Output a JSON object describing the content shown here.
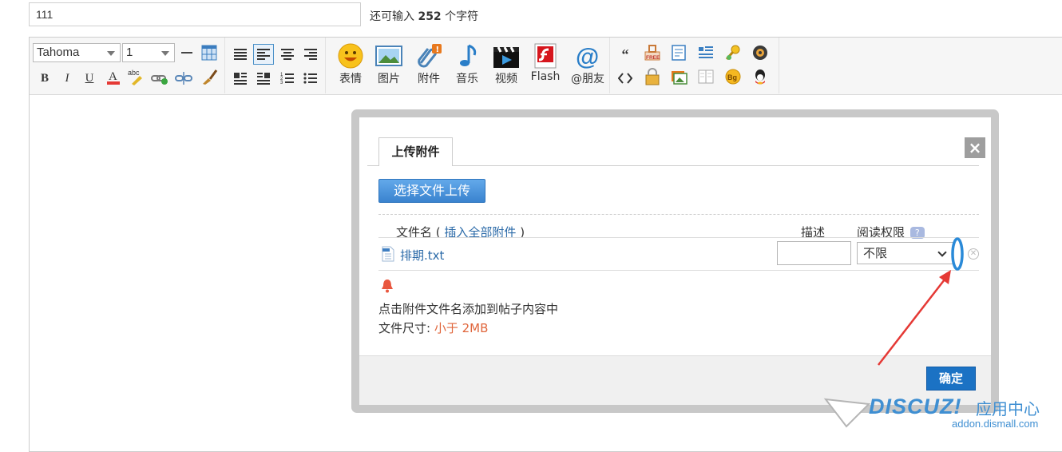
{
  "subject": {
    "value": "111"
  },
  "char_hint": {
    "prefix": "还可输入",
    "count": "252",
    "suffix": "个字符"
  },
  "toolbar": {
    "font_family": "Tahoma",
    "font_size": "1",
    "buttons": [
      {
        "name": "emoji",
        "label": "表情",
        "icon": "smiley-icon"
      },
      {
        "name": "image",
        "label": "图片",
        "icon": "image-icon"
      },
      {
        "name": "attachment",
        "label": "附件",
        "icon": "paperclip-icon"
      },
      {
        "name": "music",
        "label": "音乐",
        "icon": "music-note-icon"
      },
      {
        "name": "video",
        "label": "视频",
        "icon": "clapperboard-icon"
      },
      {
        "name": "flash",
        "label": "Flash",
        "icon": "flash-icon"
      },
      {
        "name": "mention",
        "label": "@朋友",
        "icon": "at-icon"
      }
    ]
  },
  "dialog": {
    "tab": "上传附件",
    "upload_button": "选择文件上传",
    "col_filename": "文件名",
    "insert_all_open": "( ",
    "insert_all": "插入全部附件",
    "insert_all_close": " )",
    "col_desc": "描述",
    "col_perm": "阅读权限",
    "help": "?",
    "file": {
      "name": "排期.txt",
      "desc": "",
      "perm": "不限"
    },
    "note": "点击附件文件名添加到帖子内容中",
    "size_label": "文件尺寸: ",
    "size_value": "小于 2MB",
    "ok": "确定",
    "close": "×"
  },
  "watermark": {
    "brand": "DISCUZ!",
    "suffix": "应用中心",
    "url": "addon.dismall.com"
  },
  "colors": {
    "accent": "#1b72c4",
    "annotation": "#e53935",
    "highlight": "#2a8ad8"
  }
}
